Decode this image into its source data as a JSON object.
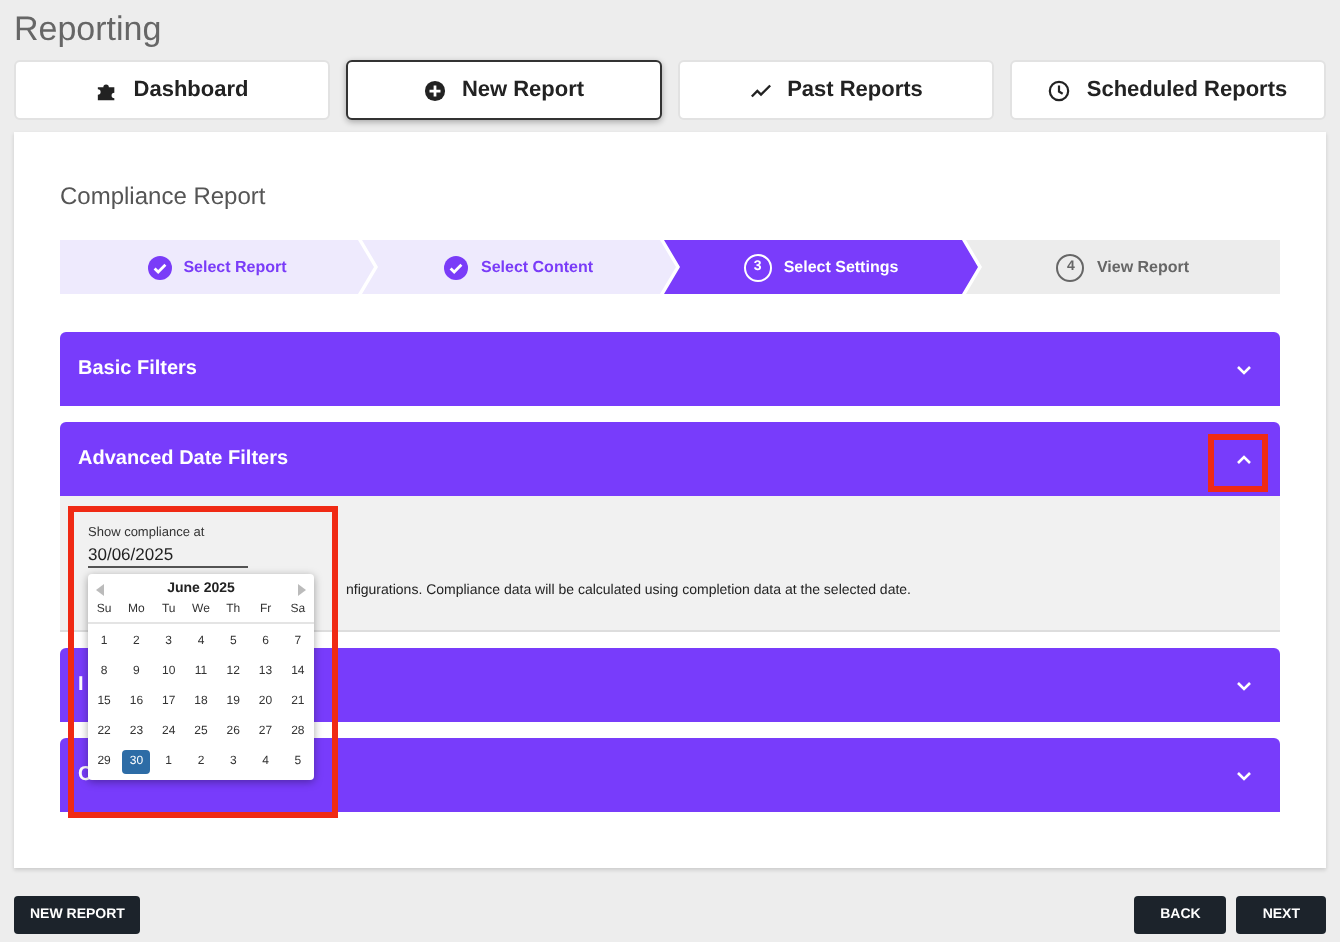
{
  "page_title": "Reporting",
  "tabs": [
    {
      "label": "Dashboard",
      "selected": false
    },
    {
      "label": "New Report",
      "selected": true
    },
    {
      "label": "Past Reports",
      "selected": false
    },
    {
      "label": "Scheduled Reports",
      "selected": false
    }
  ],
  "card_title": "Compliance Report",
  "steps": [
    {
      "label": "Select Report",
      "completed": true,
      "selected": false
    },
    {
      "label": "Select Content",
      "completed": true,
      "selected": false
    },
    {
      "number": "3",
      "label": "Select Settings",
      "completed": false,
      "selected": true
    },
    {
      "number": "4",
      "label": "View Report",
      "completed": false,
      "selected": false
    }
  ],
  "panels": [
    {
      "title": "Basic Filters",
      "expanded": false,
      "highlighted": false
    },
    {
      "title": "Advanced Date Filters",
      "expanded": true,
      "highlighted": true,
      "date_field": {
        "label": "Show compliance at",
        "value": "30/06/2025"
      },
      "description": "nfigurations. Compliance data will be calculated using completion data at the selected date.",
      "calendar": {
        "open": true,
        "month": "June 2025",
        "weekdays": [
          "Su",
          "Mo",
          "Tu",
          "We",
          "Th",
          "Fr",
          "Sa"
        ],
        "weeks": [
          [
            {
              "day": "1",
              "selected": false
            },
            {
              "day": "2",
              "selected": false
            },
            {
              "day": "3",
              "selected": false
            },
            {
              "day": "4",
              "selected": false
            },
            {
              "day": "5",
              "selected": false
            },
            {
              "day": "6",
              "selected": false
            },
            {
              "day": "7",
              "selected": false
            }
          ],
          [
            {
              "day": "8",
              "selected": false
            },
            {
              "day": "9",
              "selected": false
            },
            {
              "day": "10",
              "selected": false
            },
            {
              "day": "11",
              "selected": false
            },
            {
              "day": "12",
              "selected": false
            },
            {
              "day": "13",
              "selected": false
            },
            {
              "day": "14",
              "selected": false
            }
          ],
          [
            {
              "day": "15",
              "selected": false
            },
            {
              "day": "16",
              "selected": false
            },
            {
              "day": "17",
              "selected": false
            },
            {
              "day": "18",
              "selected": false
            },
            {
              "day": "19",
              "selected": false
            },
            {
              "day": "20",
              "selected": false
            },
            {
              "day": "21",
              "selected": false
            }
          ],
          [
            {
              "day": "22",
              "selected": false
            },
            {
              "day": "23",
              "selected": false
            },
            {
              "day": "24",
              "selected": false
            },
            {
              "day": "25",
              "selected": false
            },
            {
              "day": "26",
              "selected": false
            },
            {
              "day": "27",
              "selected": false
            },
            {
              "day": "28",
              "selected": false
            }
          ],
          [
            {
              "day": "29",
              "selected": false
            },
            {
              "day": "30",
              "selected": true
            },
            {
              "day": "1",
              "selected": false
            },
            {
              "day": "2",
              "selected": false
            },
            {
              "day": "3",
              "selected": false
            },
            {
              "day": "4",
              "selected": false
            },
            {
              "day": "5",
              "selected": false
            }
          ]
        ]
      }
    },
    {
      "title": "I",
      "expanded": false,
      "highlighted": false
    },
    {
      "title": "C",
      "expanded": false,
      "highlighted": false
    }
  ],
  "footer": {
    "left_button": "NEW REPORT",
    "right_buttons": [
      "BACK",
      "NEXT"
    ]
  }
}
